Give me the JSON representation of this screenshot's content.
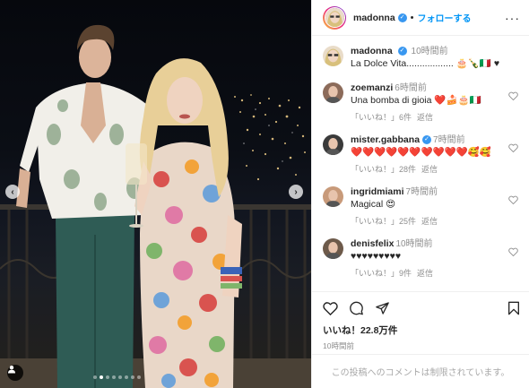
{
  "post": {
    "author": "madonna",
    "follow_label": "フォローする",
    "dot": "•",
    "more": "···",
    "caption_time": "10時間前",
    "caption": "La Dolce Vita..................  🎂🍾🇮🇹 ♥",
    "slides_total": 8,
    "slide_active": 2
  },
  "comments": [
    {
      "user": "zoemanzi",
      "time": "6時間前",
      "text": "Una bomba di gioia ❤️🍰🎂🇮🇹",
      "likes": "「いいね！」6件",
      "reply": "返信",
      "verified": false
    },
    {
      "user": "mister.gabbana",
      "time": "7時間前",
      "text": "❤️❤️❤️❤️❤️❤️❤️❤️❤️❤️🥰🥰",
      "likes": "「いいね！」28件",
      "reply": "返信",
      "verified": true
    },
    {
      "user": "ingridmiami",
      "time": "7時間前",
      "text": "Magical 😍",
      "likes": "「いいね！」25件",
      "reply": "返信",
      "verified": false
    },
    {
      "user": "denisfelix",
      "time": "10時間前",
      "text": "♥♥♥♥♥♥♥♥♥",
      "likes": "「いいね！」9件",
      "reply": "返信",
      "verified": false
    }
  ],
  "actions": {
    "likes_text": "いいね！22.8万件",
    "posted_time": "10時間前"
  },
  "footer": {
    "disabled_text": "この投稿へのコメントは制限されています。"
  },
  "colors": {
    "accent": "#0095f6",
    "verified": "#3897f0",
    "heart_red": "#ed4956",
    "muted": "#8e8e8e"
  }
}
